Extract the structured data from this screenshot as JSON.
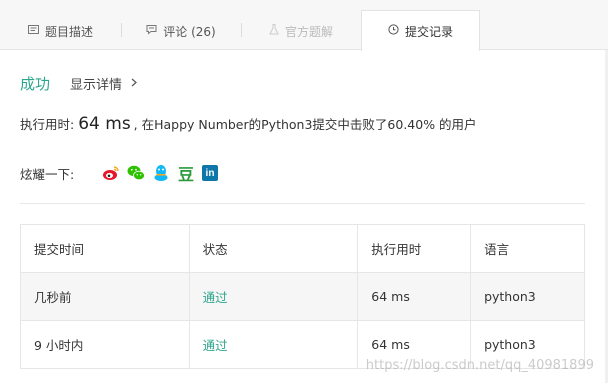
{
  "tabs": [
    {
      "label": "题目描述",
      "icon": "document-icon"
    },
    {
      "label": "评论 (26)",
      "icon": "comment-icon"
    },
    {
      "label": "官方题解",
      "icon": "flask-icon"
    },
    {
      "label": "提交记录",
      "icon": "clock-icon",
      "active": true
    }
  ],
  "result": {
    "status": "成功",
    "details_label": "显示详情",
    "summary_prefix": "执行用时:",
    "runtime": "64 ms",
    "summary_suffix": ", 在Happy Number的Python3提交中击败了60.40% 的用户"
  },
  "share": {
    "label": "炫耀一下:",
    "icons": [
      "weibo-icon",
      "wechat-icon",
      "qq-icon",
      "douban-icon",
      "linkedin-icon"
    ],
    "douban_char": "豆",
    "linkedin_text": "in"
  },
  "table": {
    "headers": [
      "提交时间",
      "状态",
      "执行用时",
      "语言"
    ],
    "rows": [
      [
        "几秒前",
        "通过",
        "64 ms",
        "python3"
      ],
      [
        "9 小时内",
        "通过",
        "64 ms",
        "python3"
      ]
    ]
  },
  "watermark": "https://blog.csdn.net/qq_40981899",
  "colors": {
    "accent": "#2ca68c",
    "weibo": "#e6162d",
    "wechat": "#2dc100",
    "qq": "#12b7f5",
    "douban": "#2a9a3c",
    "linkedin": "#0e76a8"
  }
}
